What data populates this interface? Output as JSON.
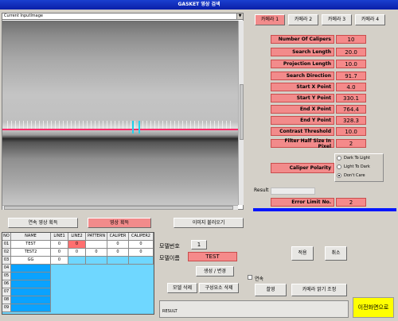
{
  "window": {
    "title": "GASKET 영상 검색"
  },
  "image_view": {
    "combo_value": "Current InputImage"
  },
  "camera_tabs": [
    "카메라 1",
    "카메라 2",
    "카메라 3",
    "카메라 4"
  ],
  "params": [
    {
      "label": "Number Of Calipers",
      "value": "10"
    },
    {
      "label": "Search Length",
      "value": "20.0"
    },
    {
      "label": "Projection Length",
      "value": "10.0"
    },
    {
      "label": "Search Direction",
      "value": "91.7"
    },
    {
      "label": "Start X Point",
      "value": "4.0"
    },
    {
      "label": "Start Y Point",
      "value": "330.1"
    },
    {
      "label": "End X Point",
      "value": "764.4"
    },
    {
      "label": "End Y Point",
      "value": "328.3"
    },
    {
      "label": "Contrast Threshold",
      "value": "10.0"
    },
    {
      "label": "Filter Half Size In Pixel",
      "value": "2"
    }
  ],
  "polarity": {
    "label": "Caliper Polarity",
    "options": [
      "Dark To Light",
      "Light To Dark",
      "Don't Care"
    ],
    "selected": "Don't Care"
  },
  "result": {
    "label": "Result",
    "value": ""
  },
  "error_limit": {
    "label": "Error Limit No.",
    "value": "2"
  },
  "bottom_buttons": {
    "continuous_capture": "연속 영상 획득",
    "capture": "영상 획득",
    "load_image": "이미지 불러오기"
  },
  "grid": {
    "headers": [
      "NO",
      "NAME",
      "LINE1",
      "LINE2",
      "PATTERN",
      "CALIPER",
      "CALIPER2"
    ],
    "rows": [
      {
        "no": "01",
        "name": "TEST",
        "cols": [
          "0",
          "0",
          "",
          "0",
          "0"
        ]
      },
      {
        "no": "02",
        "name": "TEST2",
        "cols": [
          "0",
          "0",
          "0",
          "0",
          "0"
        ]
      },
      {
        "no": "03",
        "name": "GG",
        "cols": [
          "0",
          "",
          "",
          "",
          ""
        ]
      },
      {
        "no": "04",
        "name": "",
        "cols": [
          "",
          "",
          "",
          "",
          ""
        ]
      },
      {
        "no": "05",
        "name": "",
        "cols": [
          "",
          "",
          "",
          "",
          ""
        ]
      },
      {
        "no": "06",
        "name": "",
        "cols": [
          "",
          "",
          "",
          "",
          ""
        ]
      },
      {
        "no": "07",
        "name": "",
        "cols": [
          "",
          "",
          "",
          "",
          ""
        ]
      },
      {
        "no": "08",
        "name": "",
        "cols": [
          "",
          "",
          "",
          "",
          ""
        ]
      },
      {
        "no": "09",
        "name": "",
        "cols": [
          "",
          "",
          "",
          "",
          ""
        ]
      },
      {
        "no": "10",
        "name": "",
        "cols": [
          "",
          "",
          "",
          "",
          ""
        ]
      }
    ]
  },
  "model": {
    "number_label": "모델번호",
    "number_value": "1",
    "name_label": "모델이름",
    "name_value": "TEST",
    "create_change": "생성 / 변경",
    "delete_model": "모델 삭제",
    "delete_component": "구성요소 삭제"
  },
  "actions": {
    "apply": "적용",
    "cancel": "취소",
    "checkbox_label": "연속",
    "checkbox_checked": false,
    "capture": "촬영",
    "camera_brightness": "카메라 밝기 조정",
    "result_label": "RESULT",
    "back": "이전화면으로"
  },
  "colors": {
    "accent_red": "#f28b8b",
    "title_blue": "#0a1fa8",
    "grid_cyan": "#6fd7ff",
    "grid_blue": "#0aa2ff",
    "back_yellow": "#ffff00"
  }
}
